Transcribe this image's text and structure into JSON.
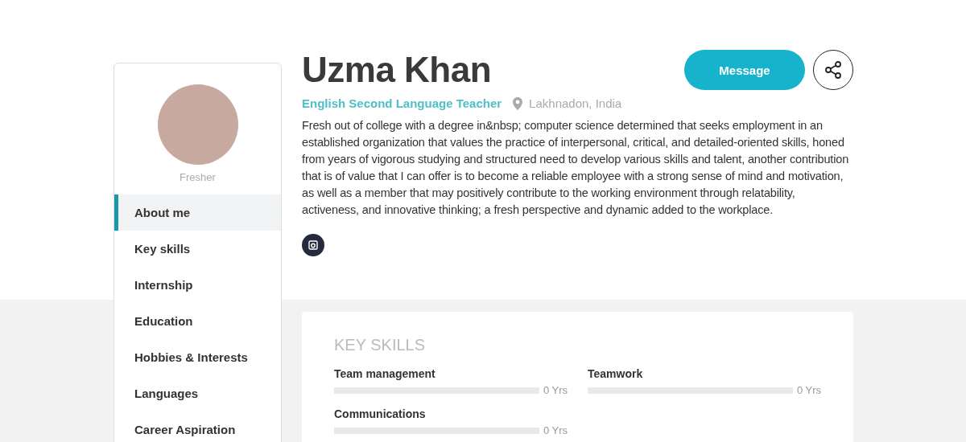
{
  "profile": {
    "name": "Uzma Khan",
    "status": "Fresher",
    "title": "English Second Language Teacher",
    "location": "Lakhnadon, India",
    "about": "Fresh out of college with a degree in&nbsp; computer science determined that seeks employment in an established organization that values the practice of interpersonal, critical, and detailed-oriented skills, honed from years of vigorous studying and structured need to develop various skills and talent, another contribution that is of value that I can offer is to become a reliable employee with a strong sense of mind and motivation, as well as a member that may positively contribute to the working environment through relatability, activeness, and innovative thinking; a fresh perspective and dynamic added to the workplace."
  },
  "actions": {
    "message": "Message"
  },
  "sidebar": {
    "items": [
      {
        "label": "About me",
        "selected": true
      },
      {
        "label": "Key skills",
        "selected": false
      },
      {
        "label": "Internship",
        "selected": false
      },
      {
        "label": "Education",
        "selected": false
      },
      {
        "label": "Hobbies & Interests",
        "selected": false
      },
      {
        "label": "Languages",
        "selected": false
      },
      {
        "label": "Career Aspiration",
        "selected": false
      }
    ]
  },
  "key_skills": {
    "heading": "KEY SKILLS",
    "skills": [
      {
        "name": "Team management",
        "level": 0,
        "reading": "0 Yrs"
      },
      {
        "name": "Teamwork",
        "level": 0,
        "reading": "0 Yrs"
      },
      {
        "name": "Communications",
        "level": 0,
        "reading": "0 Yrs"
      }
    ]
  }
}
